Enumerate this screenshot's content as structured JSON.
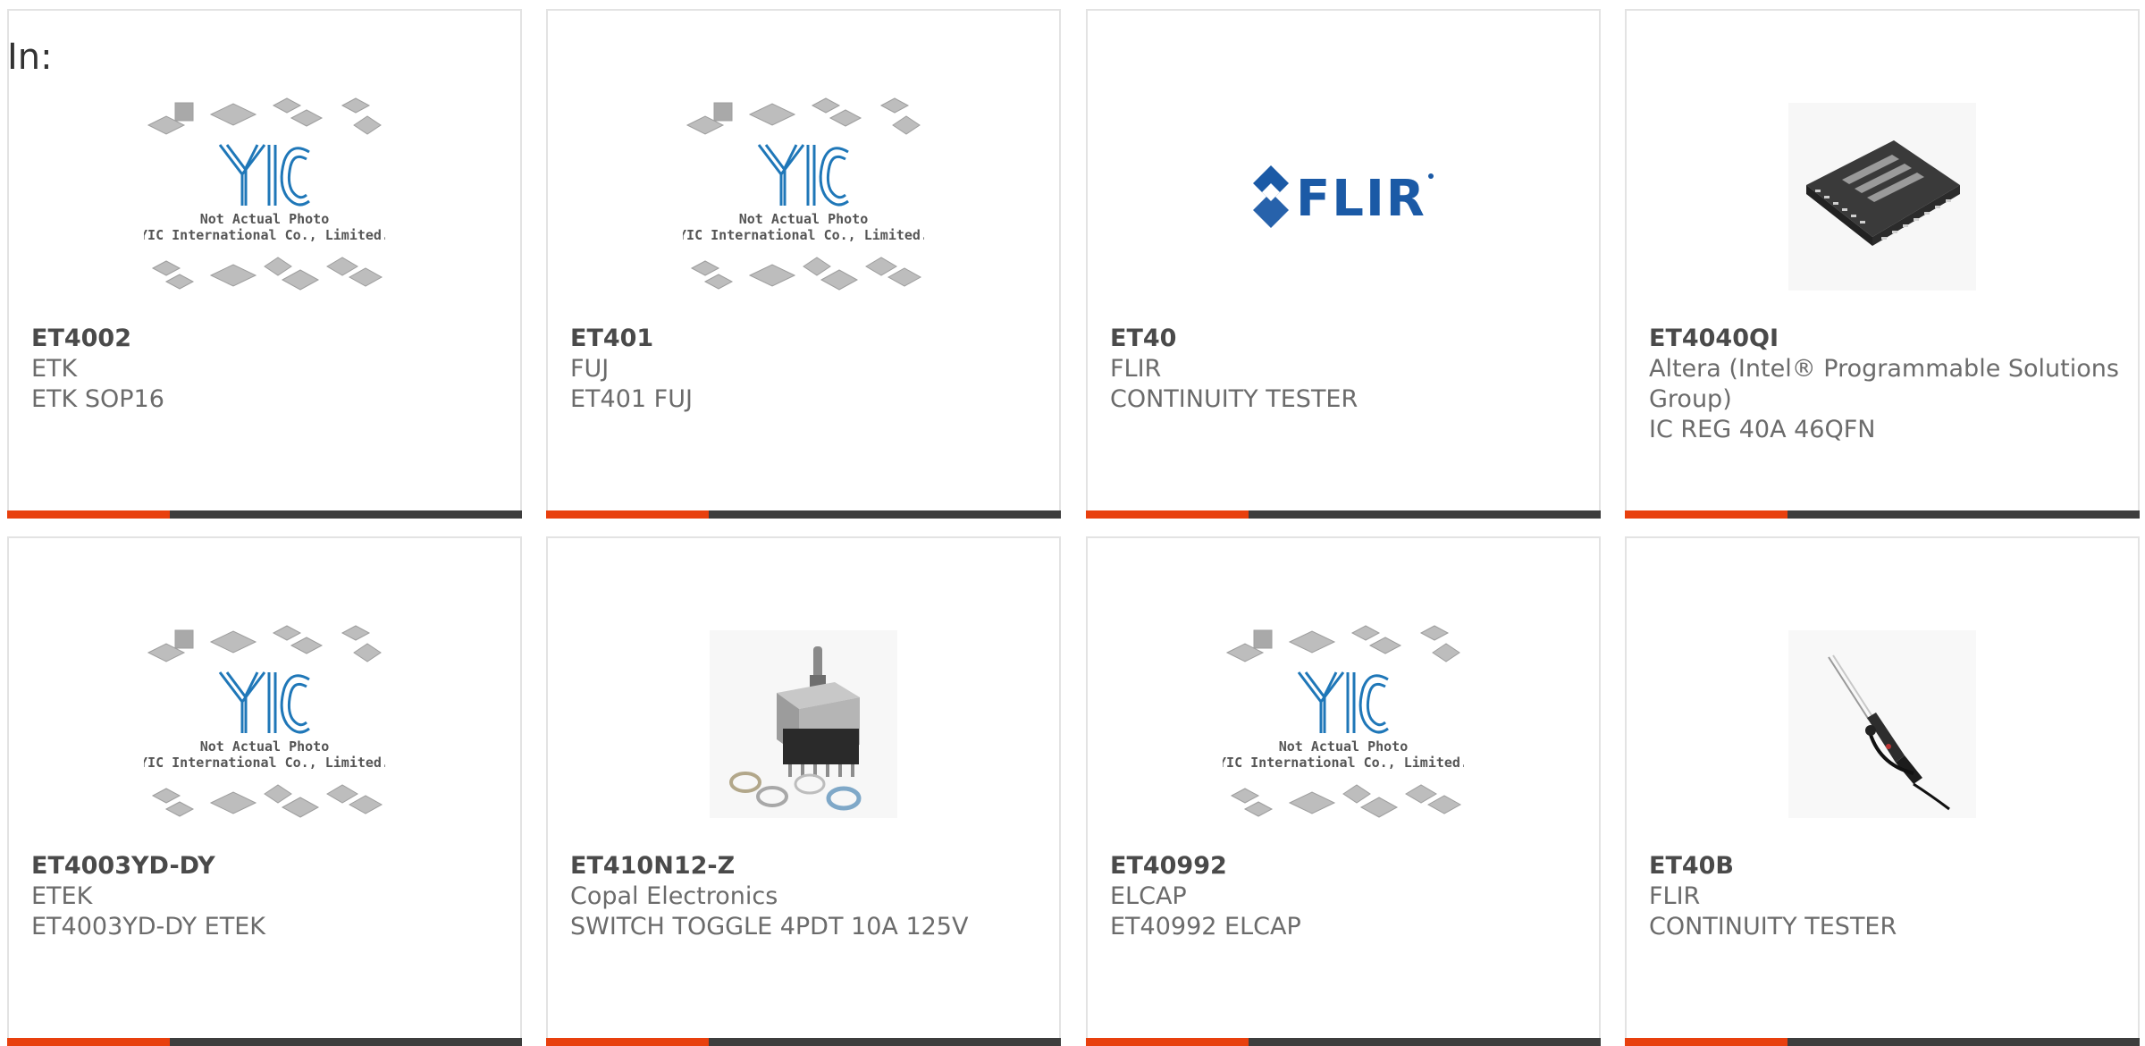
{
  "page": {
    "label": "In:"
  },
  "products": [
    {
      "part_number": "ET4002",
      "manufacturer": "ETK",
      "description": "ETK SOP16",
      "image": "yic-placeholder",
      "placeholder_text_1": "Not Actual Photo",
      "placeholder_text_2": "YIC International Co., Limited."
    },
    {
      "part_number": "ET401",
      "manufacturer": "FUJ",
      "description": "ET401 FUJ",
      "image": "yic-placeholder",
      "placeholder_text_1": "Not Actual Photo",
      "placeholder_text_2": "YIC International Co., Limited."
    },
    {
      "part_number": "ET40",
      "manufacturer": "FLIR",
      "description": "CONTINUITY TESTER",
      "image": "flir-logo"
    },
    {
      "part_number": "ET4040QI",
      "manufacturer": "Altera (Intel® Programmable Solutions Group)",
      "description": "IC REG 40A 46QFN",
      "image": "qfn-chip"
    },
    {
      "part_number": "ET4003YD-DY",
      "manufacturer": "ETEK",
      "description": "ET4003YD-DY ETEK",
      "image": "yic-placeholder",
      "placeholder_text_1": "Not Actual Photo",
      "placeholder_text_2": "YIC International Co., Limited."
    },
    {
      "part_number": "ET410N12-Z",
      "manufacturer": "Copal Electronics",
      "description": "SWITCH TOGGLE 4PDT 10A 125V",
      "image": "toggle-switch"
    },
    {
      "part_number": "ET40992",
      "manufacturer": "ELCAP",
      "description": "ET40992 ELCAP",
      "image": "yic-placeholder",
      "placeholder_text_1": "Not Actual Photo",
      "placeholder_text_2": "YIC International Co., Limited."
    },
    {
      "part_number": "ET40B",
      "manufacturer": "FLIR",
      "description": "CONTINUITY TESTER",
      "image": "tester-probe"
    }
  ],
  "colors": {
    "accent": "#e8400e",
    "bar": "#3d3d3d",
    "border": "#e3e3e3",
    "yic_blue": "#1f77b8"
  }
}
